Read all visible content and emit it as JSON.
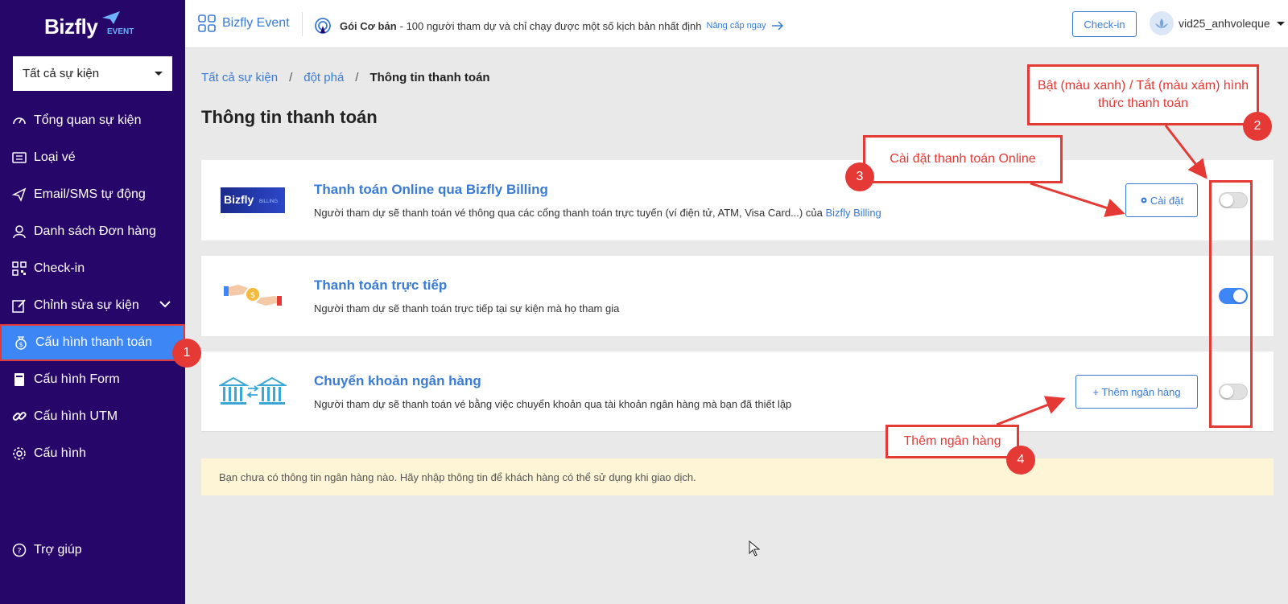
{
  "sidebar": {
    "logo_text": "Bizfly",
    "logo_sub": "EVENT",
    "event_select": "Tất cả sự kiện",
    "items": [
      {
        "label": "Tổng quan sự kiện",
        "icon": "speedometer-icon"
      },
      {
        "label": "Loại vé",
        "icon": "ticket-icon"
      },
      {
        "label": "Email/SMS tự động",
        "icon": "send-icon"
      },
      {
        "label": "Danh sách Đơn hàng",
        "icon": "user-icon"
      },
      {
        "label": "Check-in",
        "icon": "qr-code-icon"
      },
      {
        "label": "Chỉnh sửa sự kiện",
        "icon": "edit-icon"
      },
      {
        "label": "Cấu hình thanh toán",
        "icon": "money-bag-icon"
      },
      {
        "label": "Cấu hình Form",
        "icon": "book-icon"
      },
      {
        "label": "Cấu hình UTM",
        "icon": "link-icon"
      },
      {
        "label": "Cấu hình",
        "icon": "gear-icon"
      }
    ],
    "help": "Trợ giúp"
  },
  "topbar": {
    "brand": "Bizfly Event",
    "plan_name": "Gói Cơ bản",
    "plan_desc": "- 100 người tham dự và chỉ chạy được một số kịch bản nhất định",
    "upgrade": "Nâng cấp ngay",
    "checkin": "Check-in",
    "username": "vid25_anhvoleque"
  },
  "breadcrumb": {
    "all": "Tất cả sự kiện",
    "event": "đột phá",
    "sep": "/",
    "current": "Thông tin thanh toán"
  },
  "page_title": "Thông tin thanh toán",
  "methods": [
    {
      "title": "Thanh toán Online qua Bizfly Billing",
      "desc": "Người tham dự sẽ thanh toán vé thông qua các cổng thanh toán trực tuyến (ví điện tử, ATM, Visa Card...) của",
      "link": "Bizfly Billing",
      "button": "Cài đặt",
      "enabled": false,
      "logo_text": "Bizfly",
      "logo_sub": "BILLING"
    },
    {
      "title": "Thanh toán trực tiếp",
      "desc": "Người tham dự sẽ thanh toán trực tiếp tại sự kiện mà họ tham gia",
      "enabled": true
    },
    {
      "title": "Chuyển khoản ngân hàng",
      "desc": "Người tham dự sẽ thanh toán vé bằng việc chuyển khoản qua tài khoản ngân hàng mà bạn đã thiết lập",
      "button": "+ Thêm ngân hàng",
      "enabled": false
    }
  ],
  "notice": "Bạn chưa có thông tin ngân hàng nào. Hãy nhập thông tin để khách hàng có thể sử dụng khi giao dịch.",
  "annotations": {
    "a1": "1",
    "a2_text": "Bật (màu xanh) / Tắt (màu xám) hình thức thanh toán",
    "a2": "2",
    "a3_text": "Cài đặt thanh toán Online",
    "a3": "3",
    "a4_text": "Thêm ngân hàng",
    "a4": "4"
  },
  "colors": {
    "sidebar_bg": "#27066a",
    "accent": "#3a7bd5",
    "active_bg": "#3d86f5",
    "annotation_red": "#e53935",
    "notice_bg": "#fdf5d6"
  }
}
